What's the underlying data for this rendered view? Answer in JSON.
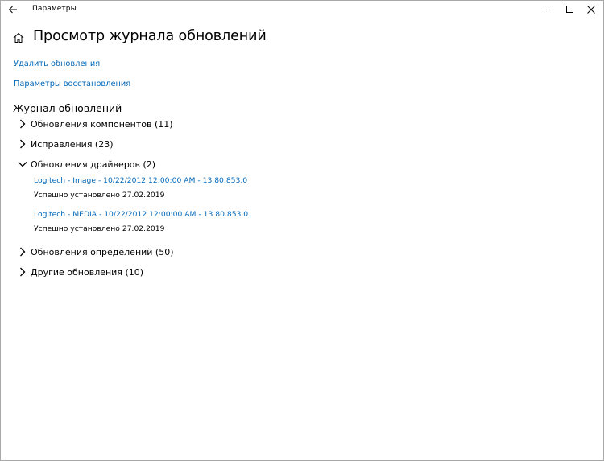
{
  "window": {
    "title": "Параметры",
    "icons": {
      "back": "back-arrow-icon",
      "minimize": "minimize-icon",
      "maximize": "maximize-icon",
      "close": "close-icon"
    }
  },
  "header": {
    "home_icon": "home-icon",
    "title": "Просмотр журнала обновлений"
  },
  "links": {
    "uninstall": "Удалить обновления",
    "recovery": "Параметры восстановления"
  },
  "history": {
    "heading": "Журнал обновлений",
    "categories": [
      {
        "label": "Обновления компонентов (11)",
        "expanded": false
      },
      {
        "label": "Исправления (23)",
        "expanded": false
      },
      {
        "label": "Обновления драйверов (2)",
        "expanded": true,
        "entries": [
          {
            "name": "Logitech - Image - 10/22/2012 12:00:00 AM - 13.80.853.0",
            "status": "Успешно установлено 27.02.2019"
          },
          {
            "name": "Logitech - MEDIA - 10/22/2012 12:00:00 AM - 13.80.853.0",
            "status": "Успешно установлено 27.02.2019"
          }
        ]
      },
      {
        "label": "Обновления определений (50)",
        "expanded": false
      },
      {
        "label": "Другие обновления (10)",
        "expanded": false
      }
    ]
  },
  "colors": {
    "link": "#0067b8",
    "text": "#000000",
    "background": "#ffffff"
  }
}
